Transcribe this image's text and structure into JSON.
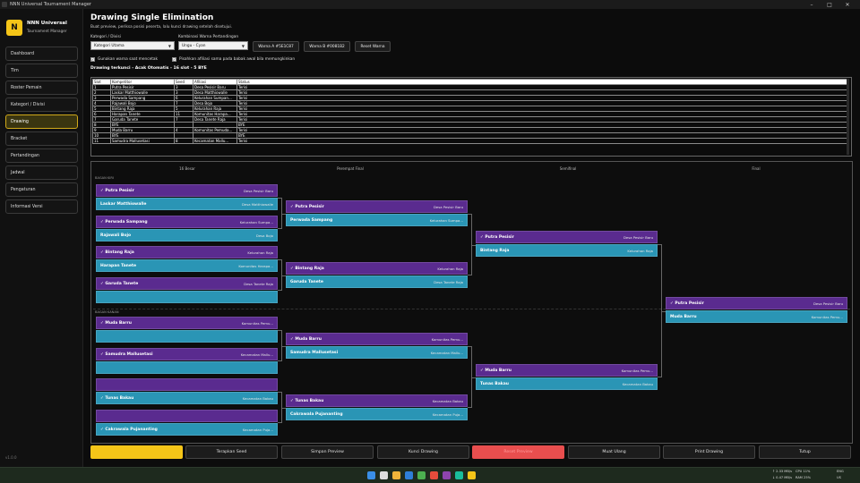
{
  "window": {
    "title": "NNN Universal Tournament Manager"
  },
  "brand": {
    "logo": "N",
    "name": "NNN Universal",
    "subtitle": "Tournament Manager"
  },
  "nav": [
    "Dashboard",
    "Tim",
    "Roster Pemain",
    "Kategori / Divisi",
    "Drawing",
    "Bracket",
    "Pertandingan",
    "Jadwal",
    "Pengaturan",
    "Informasi Versi"
  ],
  "nav_active": "Drawing",
  "version": "v1.0.0",
  "header": {
    "title": "Drawing Single Elimination",
    "lead": "Buat preview, periksa posisi peserta, lalu kunci drawing setelah disetujui."
  },
  "controls": {
    "category_label": "Kategori / Divisi",
    "category_value": "Kategori Utama",
    "color_label": "Kombinasi Warna Pertandingan",
    "color_value": "Ungu - Cyan",
    "color_a_label": "Warna A #5E1C87",
    "color_b_label": "Warna B #0081B2",
    "reset_color_label": "Reset Warna",
    "chk_print_label": "Gunakan warna saat mencetak",
    "chk_affil_label": "Pisahkan afiliasi sama pada babak awal bila memungkinkan"
  },
  "drawing_summary": "Drawing terkunci - Acak Otomatis - 16 slot - 5 BYE",
  "table": {
    "columns": [
      "Slot",
      "Kompetitor",
      "Seed",
      "Afiliasi",
      "Status"
    ],
    "rows": [
      [
        "1",
        "Putra Pesisir",
        "3",
        "Desa Pesisir Baru",
        "Terisi"
      ],
      [
        "2",
        "Laskar Matthiowalle",
        "3",
        "Desa Matthiowalle",
        "Terisi"
      ],
      [
        "3",
        "Perwada Sampang",
        "6",
        "Kelurahan Sumpan...",
        "Terisi"
      ],
      [
        "4",
        "Rajawali Bojo",
        "7",
        "Desa Bojo",
        "Terisi"
      ],
      [
        "5",
        "Bintang Raja",
        "5",
        "Kelurahan Raja",
        "Terisi"
      ],
      [
        "6",
        "Harapan Tanete",
        "11",
        "Komunitas Harapa...",
        "Terisi"
      ],
      [
        "7",
        "Garuda Tanete",
        "7",
        "Desa Tanete Raja",
        "Terisi"
      ],
      [
        "8",
        "BYE",
        "",
        "",
        "BYE"
      ],
      [
        "9",
        "Muda Barru",
        "4",
        "Komunitas Pemuda...",
        "Terisi"
      ],
      [
        "10",
        "BYE",
        "",
        "",
        "BYE"
      ],
      [
        "11",
        "Samudra Mallusetasi",
        "8",
        "Kecamatan Mallu...",
        "Terisi"
      ]
    ]
  },
  "bracket": {
    "rounds": [
      "16 Besar",
      "Perempat Final",
      "Semifinal",
      "Final"
    ],
    "sections": [
      "BAGAN KIRI",
      "BAGAN KANAN"
    ],
    "r1": [
      {
        "a": "✓ Putra Pesisir",
        "a_af": "Desa Pesisir Baru",
        "b": "Laskar Matthiowalle",
        "b_af": "Desa Matthiowalle"
      },
      {
        "a": "✓ Perwada Sampang",
        "a_af": "Kelurahan Sumpa...",
        "b": "Rajawali Bojo",
        "b_af": "Desa Bojo"
      },
      {
        "a": "✓ Bintang Raja",
        "a_af": "Kelurahan Raja",
        "b": "Harapan Tanete",
        "b_af": "Komunitas Harapa..."
      },
      {
        "a": "✓ Garuda Tanete",
        "a_af": "Desa Tanete Raja",
        "b": "",
        "b_af": ""
      },
      {
        "a": "✓ Muda Barru",
        "a_af": "Komunitas Pemu...",
        "b": "",
        "b_af": ""
      },
      {
        "a": "✓ Samudra Mallusetasi",
        "a_af": "Kecamatan Mallu...",
        "b": "",
        "b_af": ""
      },
      {
        "a": "",
        "a_af": "",
        "b": "✓ Tunas Bakau",
        "b_af": "Kecamatan Bakau"
      },
      {
        "a": "",
        "a_af": "",
        "b": "✓ Cakrawala Pujananting",
        "b_af": "Kecamatan Puja..."
      }
    ],
    "r2": [
      {
        "a": "✓ Putra Pesisir",
        "a_af": "Desa Pesisir Baru",
        "b": "Perwada Sampang",
        "b_af": "Kelurahan Sumpa..."
      },
      {
        "a": "✓ Bintang Raja",
        "a_af": "Kelurahan Raja",
        "b": "Garuda Tanete",
        "b_af": "Desa Tanete Raja"
      },
      {
        "a": "✓ Muda Barru",
        "a_af": "Komunitas Pemu...",
        "b": "Samudra Mallusetasi",
        "b_af": "Kecamatan Mallu..."
      },
      {
        "a": "✓ Tunas Bakau",
        "a_af": "Kecamatan Bakau",
        "b": "Cakrawala Pujananting",
        "b_af": "Kecamatan Puja..."
      }
    ],
    "r3": [
      {
        "a": "✓ Putra Pesisir",
        "a_af": "Desa Pesisir Baru",
        "b": "Bintang Raja",
        "b_af": "Kelurahan Raja"
      },
      {
        "a": "✓ Muda Barru",
        "a_af": "Komunitas Pemu...",
        "b": "Tunas Bakau",
        "b_af": "Kecamatan Bakau"
      }
    ],
    "final": {
      "a": "✓ Putra Pesisir",
      "a_af": "Desa Pesisir Baru",
      "b": "Muda Barru",
      "b_af": "Komunitas Pemu..."
    }
  },
  "footer": [
    "Preview Drawing",
    "Terapkan Seed",
    "Simpan Preview",
    "Kunci Drawing",
    "Reset Preview",
    "Muat Ulang",
    "Print Drawing",
    "Tutup"
  ],
  "tray": {
    "net_up": "↑ 2.33 MB/s",
    "net_down": "↓ 0.47 MB/s",
    "cpu": "CPU 11%",
    "ram": "RAM 25%",
    "lang": "ENG",
    "lang2": "US"
  },
  "colors": {
    "accent": "#f5c518",
    "match_a": "#5a2b8f",
    "match_b": "#2a95b5",
    "danger": "#e84e4e"
  }
}
